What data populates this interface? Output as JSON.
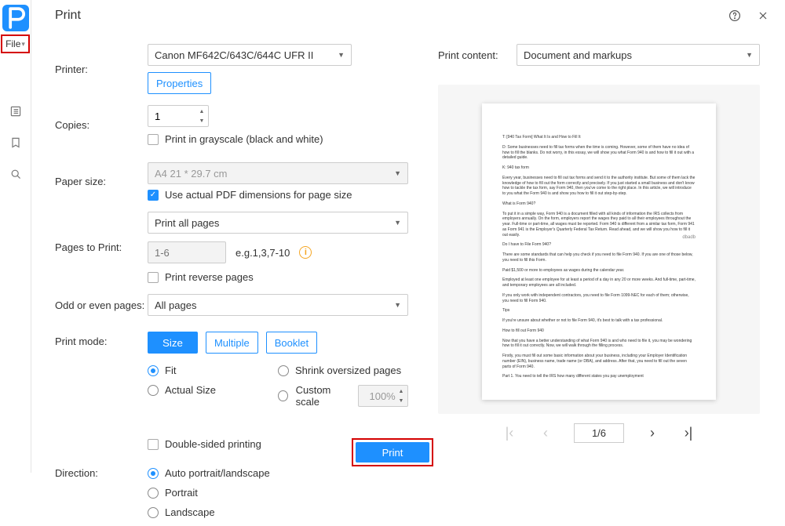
{
  "app": {
    "file_menu": "File",
    "title": "Print"
  },
  "labels": {
    "printer": "Printer:",
    "copies": "Copies:",
    "grayscale": "Print in grayscale (black and white)",
    "paper_size": "Paper size:",
    "use_actual_dims": "Use actual PDF dimensions for page size",
    "pages_to_print": "Pages to Print:",
    "range_example": "e.g.1,3,7-10",
    "reverse_pages": "Print reverse pages",
    "odd_even": "Odd or even pages:",
    "print_mode": "Print mode:",
    "mode_size": "Size",
    "mode_multiple": "Multiple",
    "mode_booklet": "Booklet",
    "opt_fit": "Fit",
    "opt_shrink": "Shrink oversized pages",
    "opt_actual": "Actual Size",
    "opt_custom": "Custom scale",
    "double_sided": "Double-sided printing",
    "direction": "Direction:",
    "dir_auto": "Auto portrait/landscape",
    "dir_portrait": "Portrait",
    "dir_landscape": "Landscape",
    "print_content": "Print content:",
    "properties": "Properties",
    "print_btn": "Print"
  },
  "values": {
    "printer": "Canon MF642C/643C/644C UFR II",
    "copies": "1",
    "paper_size": "A4 21 * 29.7 cm",
    "pages_to_print": "Print all pages",
    "range_placeholder": "1-6",
    "odd_even": "All pages",
    "custom_scale": "100%",
    "print_content": "Document and markups",
    "page_indicator": "1/6"
  },
  "preview_text": {
    "p1": "T: [940 Tax Form] What It Is and How to Fill It",
    "p2": "D: Some businesses need to fill tax forms when the time is coming. However, some of them have no idea of how to fill the blanks. Do not worry, in this essay, we will show you what Form 940 is and how to fill it out with a detailed guide.",
    "p3": "K: 940 tax form",
    "p4": "Every year, businesses need to fill out tax forms and send it to the authority institute. But some of them lack the knowledge of how to fill out the form correctly and precisely. If you just started a small business and don't know how to tackle the tax form, say Form 940, then you've come to the right place. In this article, we will introduce to you what the Form 940 is and show you how to fill it out step-by-step.",
    "p5": "What is Form 940?",
    "p6": "To put it in a simple way, Form 940 is a document filled with all kinds of information the IRS collects from employers annually. On the form, employers report the wages they paid to all their employees throughout the year. Full-time or part-time, all wages must be reported. Form 940 is different from a similar tax form, Form 941 as Form 941 is the Employer's Quarterly Federal Tax Return. Read ahead, and we will show you how to fill it out easily.",
    "wm": "dbadb",
    "p7": "Do I have to File Form 940?",
    "p8": "There are some standards that can help you check if you need to file Form 940. If you are one of those below, you need to fill this Form.",
    "p9": "Paid $1,500 or more to employees as wages during the calendar year.",
    "p10": "Employed at least one employee for at least a period of a day in any 20 or more weeks. And full-time, part-time, and temporary employees are all included.",
    "p11": "If you only work with independent contractors, you need to file Form 1099-NEC for each of them; otherwise, you need to fill Form 940.",
    "p12": "Tips",
    "p13": "If you're unsure about whether or not to file Form 940, it's best to talk with a tax professional.",
    "p14": "How to fill out Form 940",
    "p15": "Now that you have a better understanding of what Form 940 is and who need to file it, you may be wondering how to fill it out correctly. Now, we will walk through the filling process.",
    "p16": "Firstly, you must fill out some basic information about your business, including your Employer Identification number (EIN), business name, trade name (or DBA), and address. After that, you need to fill out the seven parts of Form 940.",
    "p17": "Part 1. You need to tell the IRS how many different states you pay unemployment"
  }
}
